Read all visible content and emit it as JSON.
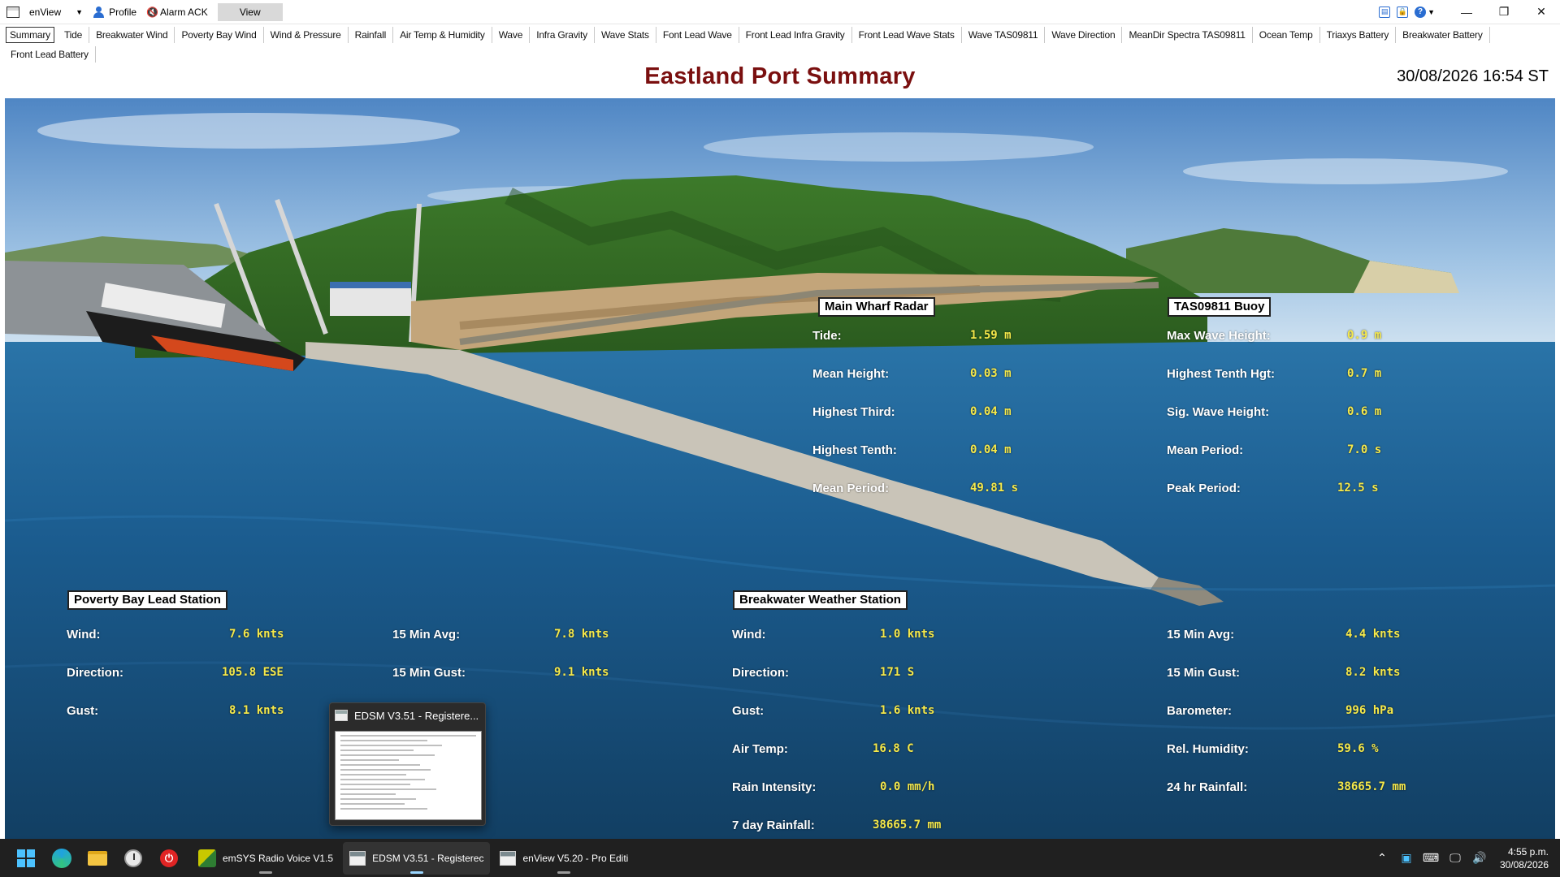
{
  "toolbar": {
    "app_name": "enView",
    "profile_label": "Profile",
    "alarm_label": "Alarm ACK",
    "view_label": "View",
    "help_label": "?"
  },
  "tabs": [
    {
      "label": "Summary",
      "active": true
    },
    {
      "label": "Tide"
    },
    {
      "label": "Breakwater Wind"
    },
    {
      "label": "Poverty Bay Wind"
    },
    {
      "label": "Wind & Pressure"
    },
    {
      "label": "Rainfall"
    },
    {
      "label": "Air Temp & Humidity"
    },
    {
      "label": "Wave"
    },
    {
      "label": "Infra Gravity"
    },
    {
      "label": "Wave Stats"
    },
    {
      "label": "Font Lead Wave"
    },
    {
      "label": "Front Lead Infra Gravity"
    },
    {
      "label": "Front Lead Wave Stats"
    },
    {
      "label": "Wave TAS09811"
    },
    {
      "label": "Wave Direction"
    },
    {
      "label": "MeanDir Spectra TAS09811"
    },
    {
      "label": "Ocean Temp"
    },
    {
      "label": "Triaxys Battery"
    },
    {
      "label": "Breakwater Battery"
    },
    {
      "label": "Front Lead Battery"
    }
  ],
  "header": {
    "title": "Eastland Port Summary",
    "datetime": "30/08/2026 16:54 ST"
  },
  "colors": {
    "title": "#7a0f0f",
    "value": "#f6e94a",
    "label": "#ffffff"
  },
  "panels": {
    "main_wharf": {
      "title": "Main Wharf Radar",
      "rows": [
        {
          "label": "Tide:",
          "value": "1.59 m"
        },
        {
          "label": "Mean Height:",
          "value": "0.03 m"
        },
        {
          "label": "Highest Third:",
          "value": "0.04 m"
        },
        {
          "label": "Highest Tenth:",
          "value": "0.04 m"
        },
        {
          "label": "Mean Period:",
          "value": "49.81 s"
        }
      ]
    },
    "buoy": {
      "title": "TAS09811 Buoy",
      "rows": [
        {
          "label": "Max Wave Height:",
          "value": "0.9 m"
        },
        {
          "label": "Highest Tenth Hgt:",
          "value": "0.7 m"
        },
        {
          "label": "Sig. Wave Height:",
          "value": "0.6 m"
        },
        {
          "label": "Mean Period:",
          "value": "7.0 s"
        },
        {
          "label": "Peak Period:",
          "value": "12.5 s"
        }
      ]
    },
    "poverty_bay": {
      "title": "Poverty Bay Lead Station",
      "left": [
        {
          "label": "Wind:",
          "value": "7.6 knts"
        },
        {
          "label": "Direction:",
          "value": "105.8 ESE"
        },
        {
          "label": "Gust:",
          "value": "8.1 knts"
        }
      ],
      "right": [
        {
          "label": "15 Min Avg:",
          "value": "7.8 knts"
        },
        {
          "label": "15 Min Gust:",
          "value": "9.1 knts"
        }
      ]
    },
    "breakwater": {
      "title": "Breakwater Weather Station",
      "left": [
        {
          "label": "Wind:",
          "value": "1.0 knts"
        },
        {
          "label": "Direction:",
          "value": "171 S"
        },
        {
          "label": "Gust:",
          "value": "1.6 knts"
        },
        {
          "label": "Air Temp:",
          "value": "16.8 C"
        },
        {
          "label": "Rain Intensity:",
          "value": "0.0 mm/h"
        },
        {
          "label": "7 day Rainfall:",
          "value": "38665.7 mm"
        }
      ],
      "right": [
        {
          "label": "15 Min Avg:",
          "value": "4.4 knts"
        },
        {
          "label": "15 Min Gust:",
          "value": "8.2 knts"
        },
        {
          "label": "Barometer:",
          "value": "996 hPa"
        },
        {
          "label": "Rel. Humidity:",
          "value": "59.6 %"
        },
        {
          "label": "24 hr Rainfall:",
          "value": "38665.7 mm"
        }
      ]
    }
  },
  "preview": {
    "title": "EDSM V3.51 - Registere..."
  },
  "taskbar": {
    "apps": [
      {
        "label": "emSYS Radio Voice V1.5"
      },
      {
        "label": "EDSM V3.51 - Registerec"
      },
      {
        "label": "enView V5.20 - Pro Editi"
      }
    ],
    "time": "4:55 p.m.",
    "date": "30/08/2026"
  }
}
